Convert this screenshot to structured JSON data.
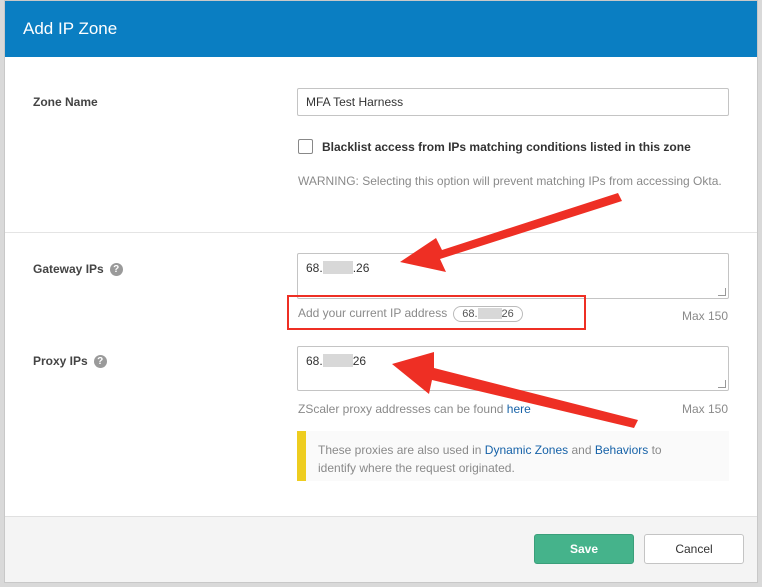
{
  "dialog": {
    "title": "Add IP Zone"
  },
  "zone_name": {
    "label": "Zone Name",
    "value": "MFA Test Harness"
  },
  "blacklist": {
    "label": "Blacklist access from IPs matching conditions listed in this zone",
    "checked": false,
    "warning": "WARNING: Selecting this option will prevent matching IPs from accessing Okta."
  },
  "gateway": {
    "label": "Gateway IPs",
    "value_prefix": "68.",
    "value_suffix": ".26",
    "add_current_label": "Add your current IP address",
    "current_ip_prefix": "68.",
    "current_ip_suffix": "26",
    "max": "Max 150"
  },
  "proxy": {
    "label": "Proxy IPs",
    "value_prefix": "68.",
    "value_suffix": "26",
    "hint_text": "ZScaler proxy addresses can be found",
    "hint_link": "here",
    "max": "Max 150"
  },
  "note": {
    "text_before": "These proxies are also used in",
    "link1": "Dynamic Zones",
    "text_and": "and",
    "link2": "Behaviors",
    "text_after": "to",
    "line2": "identify where the request originated."
  },
  "footer": {
    "save_label": "Save",
    "cancel_label": "Cancel"
  },
  "colors": {
    "header": "#0a7ec2",
    "save": "#45b38b",
    "annotation": "#ee2f24",
    "note_accent": "#eecd1f",
    "link": "#1662a8"
  },
  "icons": {
    "help": "question-circle-icon",
    "annotation": "red-arrow-icon"
  }
}
